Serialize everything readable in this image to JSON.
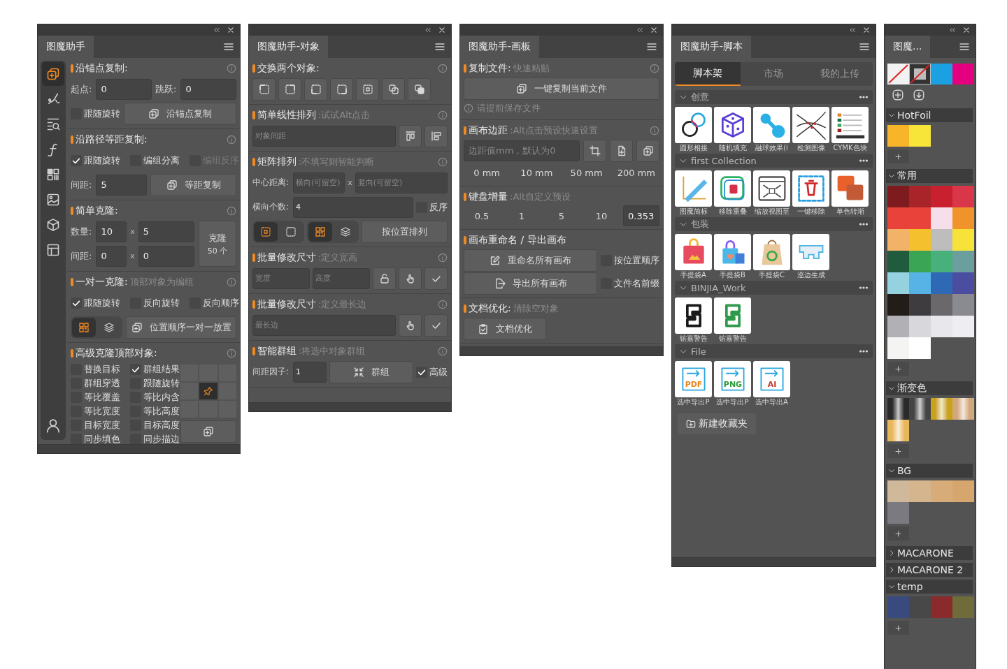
{
  "anchor_panel": {
    "title": "图魔助手",
    "sidebar": [
      {
        "selected": true
      },
      {
        "selected": false
      },
      {
        "selected": false
      },
      {
        "selected": false
      },
      {
        "selected": false
      },
      {
        "selected": false
      },
      {
        "selected": false
      },
      {
        "selected": false
      }
    ],
    "sections": [
      {
        "title": "沿锚点复制:",
        "info": true,
        "rows": [
          [
            {
              "kind": "field",
              "label": "起点:",
              "value": "0"
            },
            {
              "kind": "field",
              "label": "跳跃:",
              "value": "0"
            }
          ],
          [
            {
              "kind": "check",
              "label": "跟随旋转",
              "checked": false
            },
            {
              "kind": "copy",
              "label": "沿锚点复制"
            }
          ]
        ]
      },
      {
        "title": "沿路径等距复制:",
        "info": true,
        "rows": [
          [
            {
              "kind": "checks",
              "items": [
                {
                  "label": "跟随旋转",
                  "checked": true,
                  "disabled": false
                },
                {
                  "label": "编组分离",
                  "checked": false,
                  "disabled": false
                },
                {
                  "label": "编组反序",
                  "checked": false,
                  "disabled": true
                }
              ]
            }
          ],
          [
            {
              "kind": "field",
              "label": "间距:",
              "value": "5"
            },
            {
              "kind": "copy",
              "label": "等距复制"
            }
          ]
        ]
      },
      {
        "title": "简单克隆:",
        "info": true,
        "rows": [
          [
            {
              "kind": "field",
              "label": "数量:",
              "value": "10"
            },
            {
              "kind": "text",
              "label": "x"
            },
            {
              "kind": "field",
              "value": "5"
            }
          ],
          [
            {
              "kind": "field",
              "label": "间距:",
              "value": "0"
            },
            {
              "kind": "text",
              "label": "x"
            },
            {
              "kind": "field",
              "value": "0"
            }
          ]
        ],
        "side": {
          "kind": "button",
          "label": "克隆",
          "label2": "50 个"
        }
      },
      {
        "title": "一对一克隆:",
        "hint": "顶部对象为编组",
        "info": true,
        "rows": [
          [
            {
              "kind": "checks",
              "items": [
                {
                  "label": "跟随旋转",
                  "checked": true
                },
                {
                  "label": "反向旋转",
                  "checked": false
                },
                {
                  "label": "反向顺序",
                  "checked": false
                }
              ]
            }
          ],
          [
            {
              "kind": "toggles",
              "options": [
                {
                  "kind": "grid",
                  "selected": true
                },
                {
                  "kind": "layers",
                  "selected": false
                }
              ]
            },
            {
              "kind": "copy",
              "label": "位置顺序一对一放置"
            }
          ]
        ]
      },
      {
        "title": "高级克隆顶部对象:",
        "info": true,
        "rows": [
          [
            {
              "kind": "checkgrid",
              "items": [
                {
                  "label": "替换目标",
                  "checked": false
                },
                {
                  "label": "群组结果",
                  "checked": true
                },
                {
                  "label": "群组穿透",
                  "checked": false
                },
                {
                  "label": "跟随旋转",
                  "checked": false
                },
                {
                  "label": "等比覆盖",
                  "checked": false
                },
                {
                  "label": "等比内含",
                  "checked": false
                },
                {
                  "label": "等比宽度",
                  "checked": false
                },
                {
                  "label": "等比高度",
                  "checked": false
                },
                {
                  "label": "目标宽度",
                  "checked": false
                },
                {
                  "label": "目标高度",
                  "checked": false
                },
                {
                  "label": "同步填色",
                  "checked": false
                },
                {
                  "label": "同步描边",
                  "checked": false
                }
              ]
            }
          ]
        ],
        "side": {
          "kind": "anchor",
          "cells": [
            {
              "selected": false
            },
            {
              "selected": false
            },
            {
              "selected": false
            },
            {
              "selected": false
            },
            {
              "selected": true
            },
            {
              "selected": false
            },
            {
              "selected": false
            },
            {
              "selected": false
            },
            {
              "selected": false
            }
          ]
        }
      }
    ]
  },
  "object_panel": {
    "title": "图魔助手-对象",
    "sections": [
      {
        "title": "交换两个对象:",
        "info": true,
        "rows": [
          [
            {
              "kind": "ctl"
            },
            {
              "kind": "ctr"
            },
            {
              "kind": "cbl"
            },
            {
              "kind": "cbr"
            },
            {
              "kind": "center"
            },
            {
              "kind": "front"
            },
            {
              "kind": "back"
            }
          ]
        ]
      },
      {
        "title": "简单线性排列",
        "hint": ":试试Alt点击",
        "info": true,
        "rows": [
          [
            {
              "kind": "field",
              "placeholder": "对象间距"
            },
            {
              "kind": "alignv"
            },
            {
              "kind": "alignh"
            }
          ]
        ]
      },
      {
        "title": "矩阵排列",
        "hint": ":不填写则智能判断",
        "info": true,
        "rows": [
          [
            {
              "kind": "field",
              "label": "中心距离:",
              "placeholder": "横向(可留空)"
            },
            {
              "kind": "text",
              "label": "x"
            },
            {
              "kind": "field",
              "placeholder": "竖向(可留空)"
            }
          ],
          [
            {
              "kind": "field",
              "label": "横向个数:",
              "value": "4"
            },
            {
              "kind": "check",
              "label": "反序",
              "checked": false
            }
          ],
          [
            {
              "kind": "toggles",
              "options": [
                {
                  "kind": "center",
                  "selected": true
                },
                {
                  "kind": "frame",
                  "selected": false
                }
              ]
            },
            {
              "kind": "toggles",
              "options": [
                {
                  "kind": "grid",
                  "selected": true
                },
                {
                  "kind": "layers",
                  "selected": false
                }
              ]
            },
            {
              "kind": "button",
              "label": "按位置排列"
            }
          ]
        ]
      },
      {
        "title": "批量修改尺寸",
        "hint": ":定义宽高",
        "info": true,
        "rows": [
          [
            {
              "kind": "field",
              "placeholder": "宽度"
            },
            {
              "kind": "field",
              "placeholder": "高度"
            },
            {
              "kind": "lock"
            },
            {
              "kind": "hand"
            },
            {
              "kind": "apply"
            }
          ]
        ]
      },
      {
        "title": "批量修改尺寸",
        "hint": ":定义最长边",
        "info": true,
        "rows": [
          [
            {
              "kind": "field",
              "placeholder": "最长边"
            },
            {
              "kind": "hand"
            },
            {
              "kind": "apply"
            }
          ]
        ]
      },
      {
        "title": "智能群组",
        "hint": ":将选中对象群组",
        "info": true,
        "rows": [
          [
            {
              "kind": "field",
              "label": "间距因子:",
              "value": "1"
            },
            {
              "kind": "shrink",
              "label": "群组"
            },
            {
              "kind": "check",
              "label": "高级",
              "checked": true
            }
          ]
        ]
      }
    ]
  },
  "artboard_panel": {
    "title": "图魔助手-画板",
    "sections": [
      {
        "title": "复制文件:",
        "hint": "快速粘贴",
        "info": true,
        "rows": [
          [
            {
              "kind": "copy",
              "label": "一键复制当前文件"
            }
          ],
          [
            {
              "kind": "note",
              "label": "请提前保存文件"
            }
          ]
        ]
      },
      {
        "title": "画布边距",
        "hint": ":Alt点击预设快速设置",
        "info": true,
        "rows": [
          [
            {
              "kind": "field",
              "placeholder": "边距值mm，默认为0"
            },
            {
              "kind": "crop"
            },
            {
              "kind": "fileadd"
            },
            {
              "kind": "copy"
            }
          ],
          [
            {
              "kind": "preset",
              "label": "0 mm"
            },
            {
              "kind": "preset",
              "label": "10 mm"
            },
            {
              "kind": "preset",
              "label": "50 mm"
            },
            {
              "kind": "preset",
              "label": "200 mm"
            }
          ]
        ]
      },
      {
        "title": "键盘增量",
        "hint": ":Alt自定义预设",
        "info": false,
        "rows": [
          [
            {
              "kind": "preset",
              "label": "0.5"
            },
            {
              "kind": "preset",
              "label": "1"
            },
            {
              "kind": "preset",
              "label": "5"
            },
            {
              "kind": "preset",
              "label": "10"
            },
            {
              "kind": "field",
              "value": "0.353"
            }
          ]
        ]
      },
      {
        "title": "画布重命名 / 导出画布",
        "info": false,
        "rows": [
          [
            {
              "kind": "edit",
              "label": "重命名所有画布"
            },
            {
              "kind": "check",
              "label": "按位置顺序",
              "checked": false
            }
          ],
          [
            {
              "kind": "export",
              "label": "导出所有画布"
            },
            {
              "kind": "check",
              "label": "文件名前缀",
              "checked": false
            }
          ]
        ]
      },
      {
        "title": "文档优化:",
        "hint": "清除空对象",
        "info": false,
        "rows": [
          [
            {
              "kind": "clip",
              "label": "文档优化"
            }
          ]
        ]
      }
    ]
  },
  "script_panel": {
    "title": "图魔助手-脚本",
    "tabs": [
      {
        "label": "脚本架",
        "selected": true
      },
      {
        "label": "市场",
        "selected": false
      },
      {
        "label": "我的上传",
        "selected": false
      }
    ],
    "groups": [
      {
        "name": "创意",
        "items": [
          {
            "label": "圆形相接",
            "kind": "rings"
          },
          {
            "label": "随机填充",
            "kind": "dice"
          },
          {
            "label": "融球效果(i",
            "kind": "blobs"
          },
          {
            "label": "检测图像",
            "kind": "curves"
          },
          {
            "label": "CYMK色块",
            "kind": "list"
          }
        ]
      },
      {
        "name": "first Collection",
        "items": [
          {
            "label": "图魔简标",
            "kind": "ruler"
          },
          {
            "label": "移除重叠",
            "kind": "frametrash"
          },
          {
            "label": "缩放视图至",
            "kind": "zoom"
          },
          {
            "label": "一键移除",
            "kind": "trash"
          },
          {
            "label": "单色转渐",
            "kind": "squares"
          }
        ]
      },
      {
        "name": "包装",
        "items": [
          {
            "label": "手提袋A",
            "kind": "bag"
          },
          {
            "label": "手提袋B",
            "kind": "shopbag"
          },
          {
            "label": "手提袋C",
            "kind": "ecobag"
          },
          {
            "label": "巡边生成",
            "kind": "outline"
          }
        ]
      },
      {
        "name": "BINJIA_Work",
        "items": [
          {
            "label": "镔嘉警告",
            "kind": "smark",
            "color": "#1a1a1a"
          },
          {
            "label": "镔嘉警告",
            "kind": "smark",
            "color": "#2e9a4a"
          }
        ]
      },
      {
        "name": "File",
        "items": [
          {
            "label": "选中导出P",
            "kind": "export",
            "badge": "PDF",
            "color": "#e8861f"
          },
          {
            "label": "选中导出P",
            "kind": "export",
            "badge": "PNG",
            "color": "#2a9a3a"
          },
          {
            "label": "选中导出A",
            "kind": "export",
            "badge": "AI",
            "color": "#c0392b"
          }
        ]
      }
    ],
    "new_button": "新建收藏夹"
  },
  "swatch_panel": {
    "title": "图魔...",
    "top": [
      {
        "kind": "none"
      },
      {
        "kind": "nostroke"
      },
      {
        "kind": "color",
        "color": "#1ba1e2"
      },
      {
        "kind": "color",
        "color": "#e4007f"
      }
    ],
    "groups": [
      {
        "name": "HotFoil",
        "expanded": true,
        "swatches": [
          {
            "color": "#f9b529"
          },
          {
            "color": "#f8e53a"
          }
        ]
      },
      {
        "name": "常用",
        "expanded": true,
        "swatches": [
          {
            "color": "#7e1b1f"
          },
          {
            "color": "#a82428"
          },
          {
            "color": "#c8202e"
          },
          {
            "color": "#d93649"
          },
          {
            "color": "#e8423a"
          },
          {
            "color": "#e8423a"
          },
          {
            "color": "#f6dfea"
          },
          {
            "color": "#f0932b"
          },
          {
            "color": "#f2b267"
          },
          {
            "color": "#f5c02d"
          },
          {
            "color": "#bdbdbd"
          },
          {
            "color": "#f7e23a"
          },
          {
            "color": "#1f5b3c"
          },
          {
            "color": "#3aa655"
          },
          {
            "color": "#48b07a"
          },
          {
            "color": "#6a9f9e"
          },
          {
            "color": "#94d2e0"
          },
          {
            "color": "#57b3e6"
          },
          {
            "color": "#2f68b5"
          },
          {
            "color": "#4b4ea0"
          },
          {
            "color": "#231d1a"
          },
          {
            "color": "#3e3c3e"
          },
          {
            "color": "#6a686b"
          },
          {
            "color": "#8a8b90"
          },
          {
            "color": "#b1b1b5"
          },
          {
            "color": "#d8d8dc"
          },
          {
            "color": "#e8e8ec"
          },
          {
            "color": "#eeeef2"
          },
          {
            "color": "#f4f4f2"
          },
          {
            "color": "#ffffff"
          }
        ]
      },
      {
        "name": "渐变色",
        "expanded": true,
        "swatches": [
          {
            "kind": "gradient",
            "color": "#2a2a2a"
          },
          {
            "kind": "gradient",
            "color": "#444444"
          },
          {
            "kind": "gradient",
            "color": "#c9a21a"
          },
          {
            "kind": "gradient",
            "color": "#d2a77c"
          },
          {
            "kind": "gradient",
            "color": "#e8b75a"
          }
        ]
      },
      {
        "name": "BG",
        "expanded": true,
        "swatches": [
          {
            "color": "#cfb99a"
          },
          {
            "color": "#d4b58e"
          },
          {
            "color": "#d8ac78"
          },
          {
            "color": "#d7a66f"
          },
          {
            "color": "#7a7a80"
          }
        ]
      },
      {
        "name": "MACARONE",
        "expanded": false
      },
      {
        "name": "MACARONE 2",
        "expanded": false
      },
      {
        "name": "temp",
        "expanded": true,
        "swatches": [
          {
            "color": "#394a7e"
          },
          {
            "color": "#484848"
          },
          {
            "color": "#8a2a2c"
          },
          {
            "color": "#6f6b3a"
          }
        ]
      }
    ]
  }
}
